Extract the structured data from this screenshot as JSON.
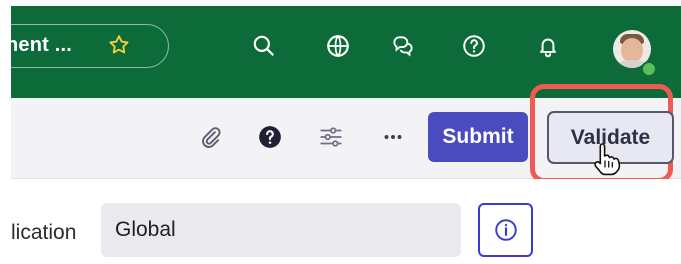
{
  "header": {
    "title_truncated": "nent ...",
    "icons": [
      "star-icon",
      "search-icon",
      "globe-icon",
      "chat-icon",
      "help-icon",
      "bell-icon",
      "avatar"
    ],
    "bg": "#0d6b3a"
  },
  "toolbar": {
    "icons": [
      "paperclip-icon",
      "help-circle-icon",
      "sliders-icon",
      "more-icon"
    ],
    "submit_label": "Submit",
    "validate_label": "Validate"
  },
  "field": {
    "label_partial": "lication",
    "value": "Global"
  },
  "colors": {
    "accent": "#4b4bc0",
    "highlight": "#ef5b52",
    "status": "#5ac05a"
  }
}
